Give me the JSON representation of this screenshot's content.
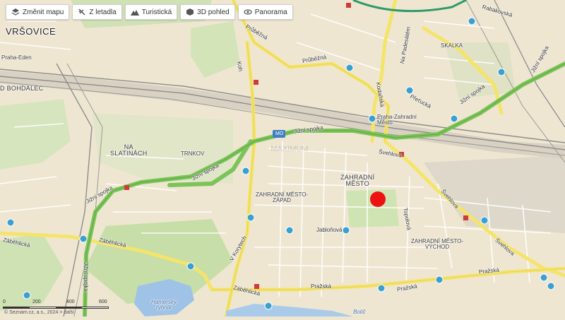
{
  "toolbar": {
    "change_map": "Změnit mapu",
    "aerial": "Z letadla",
    "tourist": "Turistická",
    "view_3d": "3D pohled",
    "panorama": "Panorama"
  },
  "map": {
    "district_big": "VRŠOVICE",
    "district_bohdalec": "D BOHDALEC",
    "na_slatinach": "NA\nSLATINÁCH",
    "trnkov": "TRNKOV",
    "zahradni_mesto": "ZAHRADNÍ\nMĚSTO",
    "zahradni_mesto_zapad": "ZAHRADNÍ MĚSTO-\nZÁPAD",
    "zahradni_mesto_vychod": "ZAHRADNÍ MĚSTO-\nVÝCHOD",
    "skalka": "SKALKA",
    "praha_eden": "Praha-Eden",
    "praha_zahradni_mesto": "Praha-Zahradní\nMěsto",
    "rabakovska": "Rabakovská",
    "prubezna_1": "Průběžná",
    "prubezna_2": "Průběžná",
    "na_padesatem": "Na Padesátém",
    "kodanska": "Kodaňská",
    "prelucka": "Přeťucká",
    "jizni_spojka_1": "Jižní spojka",
    "jizni_spojka_2": "Jižní spojka",
    "jizni_spojka_3": "Jižní spojka",
    "jizni_spojka_4": "Jižní spojka",
    "jizni_spojka_5": "Jižní spojka",
    "jizni_spojka_6": "Jižní spojka",
    "svehlova_1": "Švehlova",
    "svehlova_2": "Švehlova",
    "svehlova_3": "Švehlova",
    "koh": "Koh",
    "zabehlicka_1": "Záběhlická",
    "zabehlicka_2": "Záběhlická",
    "zabehlicka_3": "Záběhlická",
    "jablonova": "Jabloňová",
    "v_korytech": "V Korytech",
    "prazska_1": "Pražská",
    "prazska_2": "Pražská",
    "prazska_3": "Pražská",
    "topolova": "Topolová",
    "hamersky_rybnik": "Hamerský\nrybník",
    "botic": "Botič",
    "mo_shield": "MO",
    "watermark": "MAXIMUM"
  },
  "scale": {
    "labels": [
      "0",
      "200",
      "400",
      "600"
    ]
  },
  "copyright": "© Seznam.cz, a.s., 2024  >  další",
  "colors": {
    "background": "#efe6d2",
    "arterial": "#f4e46a",
    "motorway": "#7cc45a",
    "rail": "#8d8d8d",
    "park": "#cfe3b2",
    "water": "#9ec3e6",
    "marker": "#ee1111"
  }
}
